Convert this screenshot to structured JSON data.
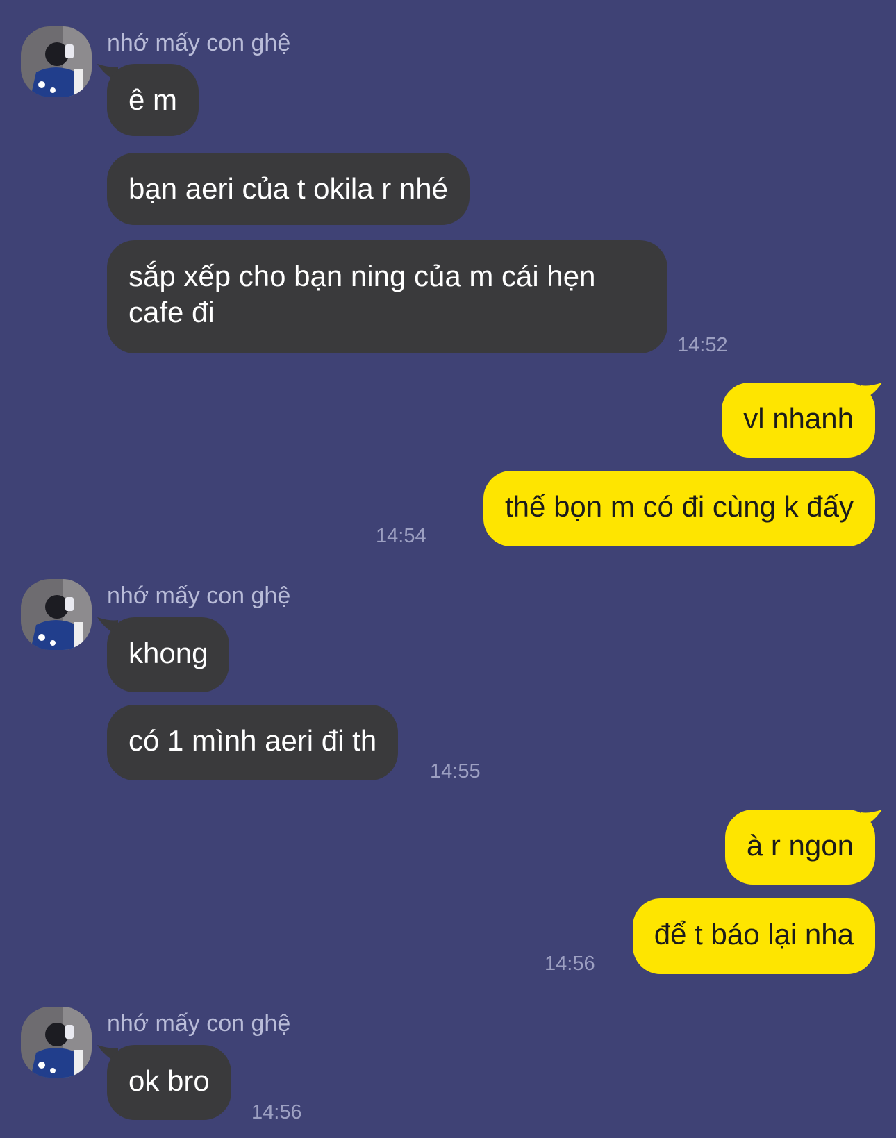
{
  "theme": {
    "background": "#3f4275",
    "incoming_bubble": "#3a3a3c",
    "outgoing_bubble": "#fee500"
  },
  "groups": [
    {
      "sender": "nhớ mấy con ghệ",
      "messages": [
        "ê m",
        "bạn aeri của t okila r nhé",
        "sắp xếp cho bạn ning của m cái hẹn cafe đi"
      ],
      "time": "14:52"
    },
    {
      "messages": [
        "vl nhanh",
        "thế bọn m có đi cùng k đấy"
      ],
      "time": "14:54"
    },
    {
      "sender": "nhớ mấy con ghệ",
      "messages": [
        "khong",
        "có 1 mình aeri đi th"
      ],
      "time": "14:55"
    },
    {
      "messages": [
        "à r ngon",
        "để t báo lại nha"
      ],
      "time": "14:56"
    },
    {
      "sender": "nhớ mấy con ghệ",
      "messages": [
        "ok bro"
      ],
      "time": "14:56"
    }
  ]
}
